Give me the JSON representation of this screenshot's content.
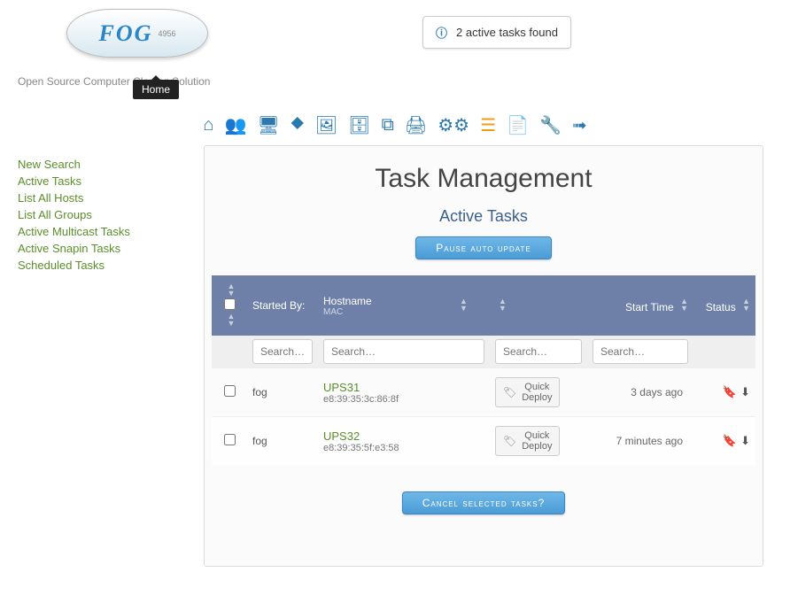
{
  "logo": {
    "text": "FOG",
    "version": "4956"
  },
  "tagline": "Open Source Computer Cloning Solution",
  "tooltip": "Home",
  "notification": {
    "text": "2 active tasks found"
  },
  "nav_icons": [
    {
      "name": "home-icon",
      "glyph": "⌂",
      "active": false
    },
    {
      "name": "users-icon",
      "glyph": "👥",
      "active": false
    },
    {
      "name": "monitor-icon",
      "glyph": "🖥",
      "active": false
    },
    {
      "name": "network-icon",
      "glyph": "⯁",
      "active": false
    },
    {
      "name": "image-icon",
      "glyph": "🖼",
      "active": false
    },
    {
      "name": "storage-icon",
      "glyph": "🗄",
      "active": false
    },
    {
      "name": "copy-icon",
      "glyph": "⧉",
      "active": false
    },
    {
      "name": "print-icon",
      "glyph": "🖨",
      "active": false
    },
    {
      "name": "gears-icon",
      "glyph": "⚙⚙",
      "active": false
    },
    {
      "name": "tasks-icon",
      "glyph": "☰",
      "active": true
    },
    {
      "name": "file-icon",
      "glyph": "📄",
      "active": false
    },
    {
      "name": "wrench-icon",
      "glyph": "🔧",
      "active": false
    },
    {
      "name": "logout-icon",
      "glyph": "➟",
      "active": false
    }
  ],
  "sidebar": {
    "items": [
      {
        "label": "New Search"
      },
      {
        "label": "Active Tasks"
      },
      {
        "label": "List All Hosts"
      },
      {
        "label": "List All Groups"
      },
      {
        "label": "Active Multicast Tasks"
      },
      {
        "label": "Active Snapin Tasks"
      },
      {
        "label": "Scheduled Tasks"
      }
    ]
  },
  "page": {
    "title": "Task Management",
    "subtitle": "Active Tasks"
  },
  "buttons": {
    "pause": "Pause auto update",
    "cancel": "Cancel selected tasks?"
  },
  "columns": {
    "started_by": "Started By:",
    "hostname": "Hostname",
    "hostname_sub": "MAC",
    "start_time": "Start Time",
    "status": "Status"
  },
  "filters": {
    "placeholder": "Search…"
  },
  "quick_deploy": {
    "label_line1": "Quick",
    "label_line2": "Deploy"
  },
  "rows": [
    {
      "started_by": "fog",
      "hostname": "UPS31",
      "mac": "e8:39:35:3c:86:8f",
      "time": "3 days ago"
    },
    {
      "started_by": "fog",
      "hostname": "UPS32",
      "mac": "e8:39:35:5f:e3:58",
      "time": "7 minutes ago"
    }
  ]
}
